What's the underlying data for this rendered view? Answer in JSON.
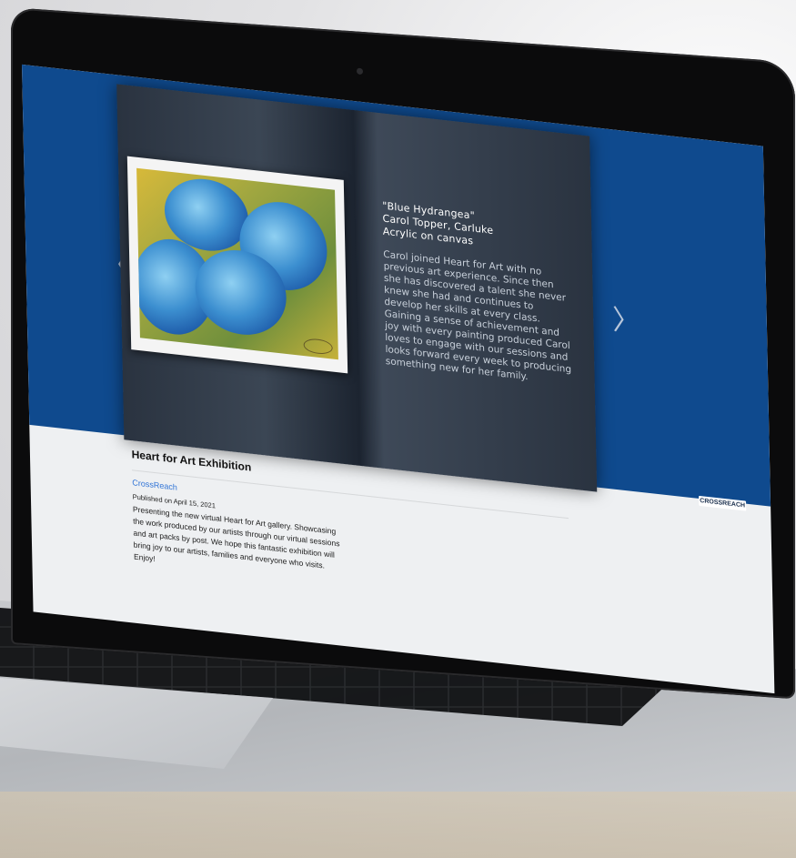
{
  "viewer": {
    "prev_glyph": "〈",
    "next_glyph": "〉",
    "brand_badge": "CROSSREACH",
    "colors": {
      "background": "#0f4a8e",
      "page": "#2f3a48"
    }
  },
  "artwork": {
    "title": "\"Blue Hydrangea\"",
    "artist_line": "Carol Topper, Carluke",
    "medium": "Acrylic on canvas",
    "description": "Carol joined Heart for Art with no previous art experience. Since then she has discovered a talent she never knew she had and continues to develop her skills at every class. Gaining a sense of achievement and joy with every painting produced Carol loves to engage with our sessions and looks forward every week to producing something new for her family."
  },
  "post": {
    "title": "Heart for Art Exhibition",
    "author": "CrossReach",
    "published": "Published on April 15, 2021",
    "body": "Presenting the new virtual Heart for Art gallery. Showcasing the work produced by our artists through our virtual sessions and art packs by post. We hope this fantastic exhibition will bring joy to our artists, families and everyone who visits. Enjoy!",
    "author_color": "#2f73d6"
  }
}
